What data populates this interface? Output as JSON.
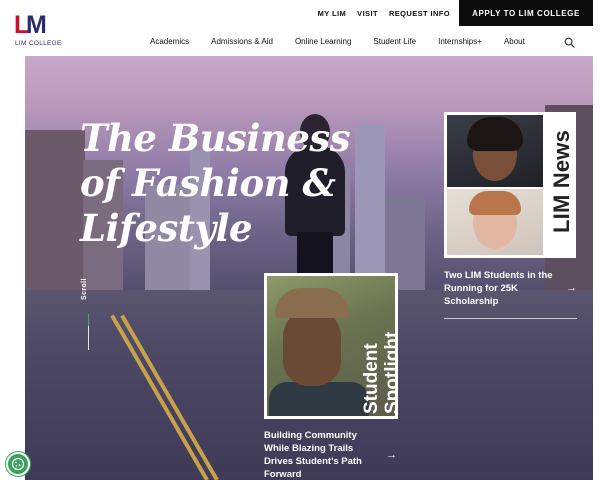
{
  "header": {
    "logo": {
      "mark_l": "L",
      "mark_m": "M",
      "sub": "LIM COLLEGE"
    },
    "util_nav": [
      "MY LIM",
      "VISIT",
      "REQUEST INFO"
    ],
    "apply_button": "APPLY TO LIM COLLEGE",
    "main_nav": [
      "Academics",
      "Admissions & Aid",
      "Online Learning",
      "Student Life",
      "Internships+",
      "About"
    ],
    "search_icon": "search-icon"
  },
  "hero": {
    "title": "The Business of Fashion & Lifestyle",
    "scroll_label": "Scroll"
  },
  "news": {
    "vertical_label": "LIM News",
    "headline": "Two LIM Students in the Running for 25K Scholarship",
    "arrow": "→"
  },
  "spotlight": {
    "vertical_label_1": "Student",
    "vertical_label_2": "Spotlight",
    "headline": "Building Community While Blazing Trails Drives Student’s Path Forward",
    "arrow": "→"
  },
  "colors": {
    "logo_red": "#c8102e",
    "logo_navy": "#2a2b6e",
    "apply_bg": "#0b0b0b",
    "scroll_accent": "#2bb673",
    "cookie_green": "#3aa25b"
  },
  "cookie_button": {
    "icon": "cookie-icon"
  }
}
